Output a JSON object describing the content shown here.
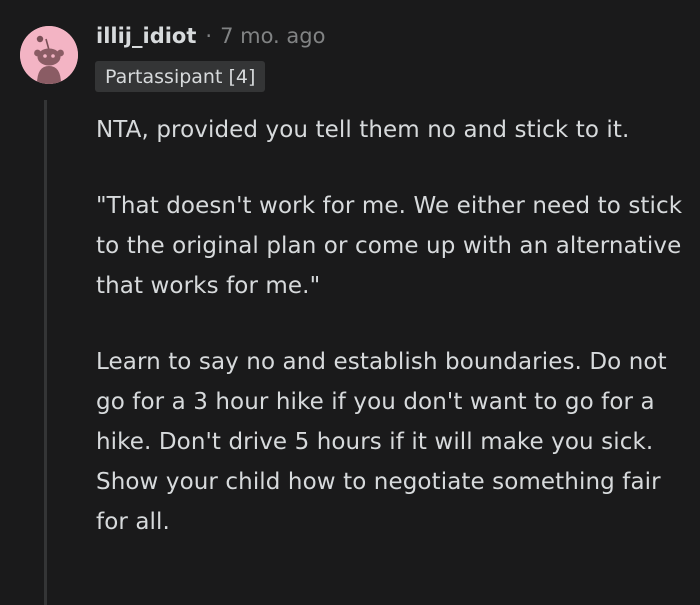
{
  "comment": {
    "author": "illij_idiot",
    "separator": "·",
    "timestamp": "7 mo. ago",
    "flair": "Partassipant [4]",
    "avatar_icon": "reddit-snoo-avatar-icon",
    "avatar_color": "#f3b4c4",
    "paragraphs": [
      "NTA, provided you tell them no and stick to it.",
      "\"That doesn't work for me. We either need to stick to the original plan or come up with an alternative that works for me.\"",
      "Learn to say no and establish boundaries. Do not go for a 3 hour hike if you don't want to go for a hike. Don't drive 5 hours if it will make you sick. Show your child how to negotiate something fair for all."
    ]
  },
  "colors": {
    "background": "#1a1a1b",
    "text": "#d7dadc",
    "meta": "#818384",
    "flair_bg": "#343536",
    "thread_line": "#343536"
  }
}
